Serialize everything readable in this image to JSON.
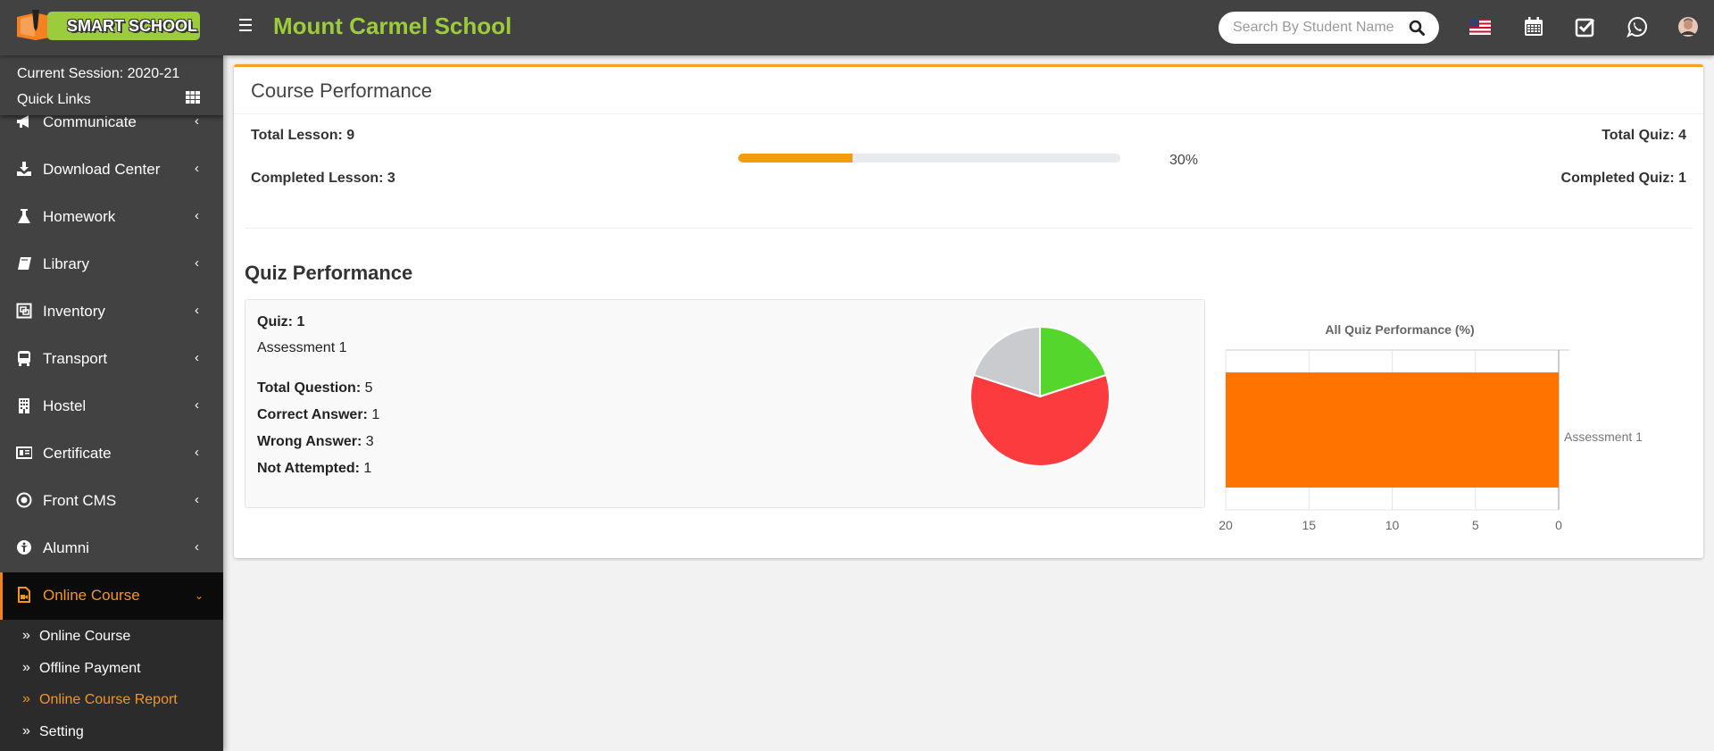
{
  "header": {
    "logo_text": "SMART SCHOOL",
    "school_name": "Mount Carmel School",
    "search_placeholder": "Search By Student Name",
    "icons": [
      "menu-toggle-icon",
      "search-icon",
      "us-flag-icon",
      "calendar-icon",
      "check-square-icon",
      "whatsapp-icon",
      "user-avatar"
    ]
  },
  "sidebar": {
    "session_label": "Current Session: 2020-21",
    "quick_links_label": "Quick Links",
    "items": [
      {
        "label": "Communicate",
        "icon": "bullhorn-icon"
      },
      {
        "label": "Download Center",
        "icon": "download-icon"
      },
      {
        "label": "Homework",
        "icon": "flask-icon"
      },
      {
        "label": "Library",
        "icon": "book-icon"
      },
      {
        "label": "Inventory",
        "icon": "inventory-icon"
      },
      {
        "label": "Transport",
        "icon": "bus-icon"
      },
      {
        "label": "Hostel",
        "icon": "building-icon"
      },
      {
        "label": "Certificate",
        "icon": "certificate-icon"
      },
      {
        "label": "Front CMS",
        "icon": "cms-icon"
      },
      {
        "label": "Alumni",
        "icon": "alumni-icon"
      },
      {
        "label": "Online Course",
        "icon": "video-file-icon",
        "active": true
      }
    ],
    "submenu": [
      {
        "label": "Online Course"
      },
      {
        "label": "Offline Payment"
      },
      {
        "label": "Online Course Report",
        "active": true
      },
      {
        "label": "Setting"
      }
    ],
    "active_color": "#f5961e"
  },
  "course_performance": {
    "title": "Course Performance",
    "total_lesson": "Total Lesson: 9",
    "completed_lesson": "Completed Lesson: 3",
    "total_quiz": "Total Quiz: 4",
    "completed_quiz": "Completed Quiz: 1",
    "progress_percent": 30,
    "progress_label": "30%"
  },
  "quiz_performance": {
    "title": "Quiz Performance",
    "quiz_label": "Quiz: 1",
    "quiz_name": "Assessment 1",
    "total_question_label": "Total Question:",
    "total_question": "5",
    "correct_answer_label": "Correct Answer:",
    "correct_answer": "1",
    "wrong_answer_label": "Wrong Answer:",
    "wrong_answer": "3",
    "not_attempted_label": "Not Attempted:",
    "not_attempted": "1"
  },
  "chart_data": [
    {
      "type": "pie",
      "title": "",
      "labels": [
        "Correct Answer",
        "Wrong Answer",
        "Not Attempted"
      ],
      "values": [
        1,
        3,
        1
      ],
      "colors": [
        "#54d62c",
        "#fb3b3e",
        "#c9cbcf"
      ]
    },
    {
      "type": "bar",
      "orientation": "horizontal",
      "title": "All Quiz Performance (%)",
      "categories": [
        "Assessment 1"
      ],
      "values": [
        20
      ],
      "xlim": [
        0,
        20
      ],
      "x_ticks": [
        "20",
        "15",
        "10",
        "5",
        "0"
      ],
      "x_reversed": true,
      "category_axis_position": "right",
      "color": "#ff7400",
      "grid": true
    }
  ]
}
